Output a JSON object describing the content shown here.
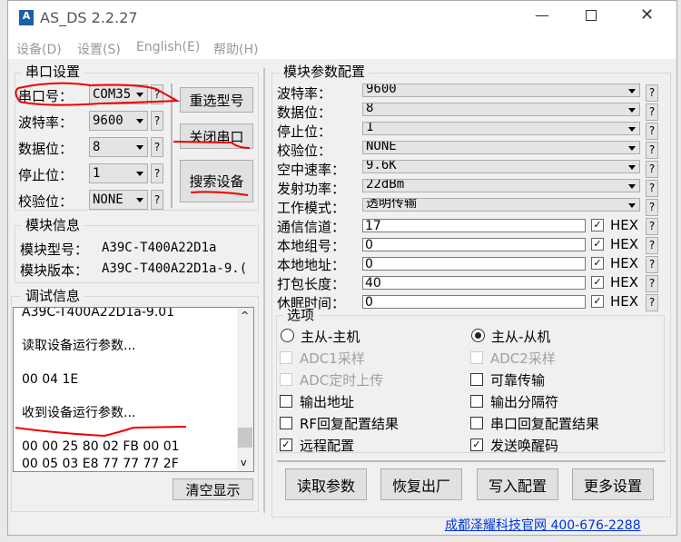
{
  "window": {
    "title": "AS_DS 2.2.27",
    "logo": "ASDS"
  },
  "menu": [
    "设备(D)",
    "设置(S)",
    "English(E)",
    "帮助(H)"
  ],
  "serial": {
    "title": "串口设置",
    "rows": [
      {
        "label": "串口号：",
        "value": "COM35"
      },
      {
        "label": "波特率：",
        "value": "9600"
      },
      {
        "label": "数据位：",
        "value": "8"
      },
      {
        "label": "停止位：",
        "value": "1"
      },
      {
        "label": "校验位：",
        "value": "NONE"
      }
    ],
    "buttons": {
      "reselect": "重选型号",
      "close": "关闭串口",
      "search": "搜索设备"
    }
  },
  "module_info": {
    "title": "模块信息",
    "model_label": "模块型号：",
    "model": "A39C-T400A22D1a",
    "version_label": "模块版本：",
    "version": "A39C-T400A22D1a-9.("
  },
  "debug": {
    "title": "调试信息",
    "lines": [
      "A39C-T400A22D1a-9.01",
      "",
      "读取设备运行参数...",
      "",
      "00 04 1E",
      "",
      "收到设备运行参数...",
      "",
      "00 00 25 80 02 FB 00 01",
      "00 05 03 E8 77 77 77 2F"
    ],
    "clear": "清空显示"
  },
  "params": {
    "title": "模块参数配置",
    "help": "?",
    "hex": "HEX",
    "combos": [
      {
        "label": "波特率：",
        "value": "9600"
      },
      {
        "label": "数据位：",
        "value": "8"
      },
      {
        "label": "停止位：",
        "value": "1"
      },
      {
        "label": "校验位：",
        "value": "NONE"
      },
      {
        "label": "空中速率：",
        "value": "9.6K"
      },
      {
        "label": "发射功率：",
        "value": "22dBm"
      },
      {
        "label": "工作模式：",
        "value": "透明传输"
      }
    ],
    "inputs": [
      {
        "label": "通信信道：",
        "value": "17"
      },
      {
        "label": "本地组号：",
        "value": "0"
      },
      {
        "label": "本地地址：",
        "value": "0"
      },
      {
        "label": "打包长度：",
        "value": "40"
      },
      {
        "label": "休眠时间：",
        "value": "0"
      }
    ]
  },
  "options": {
    "title": "选项",
    "radio_master": "主从-主机",
    "radio_slave": "主从-从机",
    "selected": "主从-从机",
    "checks": [
      {
        "label": "ADC1采样",
        "checked": false,
        "disabled": true
      },
      {
        "label": "ADC2采样",
        "checked": false,
        "disabled": true
      },
      {
        "label": "ADC定时上传",
        "checked": false,
        "disabled": true
      },
      {
        "label": "可靠传输",
        "checked": false,
        "disabled": false
      },
      {
        "label": "输出地址",
        "checked": false,
        "disabled": false
      },
      {
        "label": "输出分隔符",
        "checked": false,
        "disabled": false
      },
      {
        "label": "RF回复配置结果",
        "checked": false,
        "disabled": false
      },
      {
        "label": "串口回复配置结果",
        "checked": false,
        "disabled": false
      },
      {
        "label": "远程配置",
        "checked": true,
        "disabled": false
      },
      {
        "label": "发送唤醒码",
        "checked": true,
        "disabled": false
      }
    ]
  },
  "actions": [
    "读取参数",
    "恢复出厂",
    "写入配置",
    "更多设置"
  ],
  "footer_link": "成都泽耀科技官网 400-676-2288"
}
